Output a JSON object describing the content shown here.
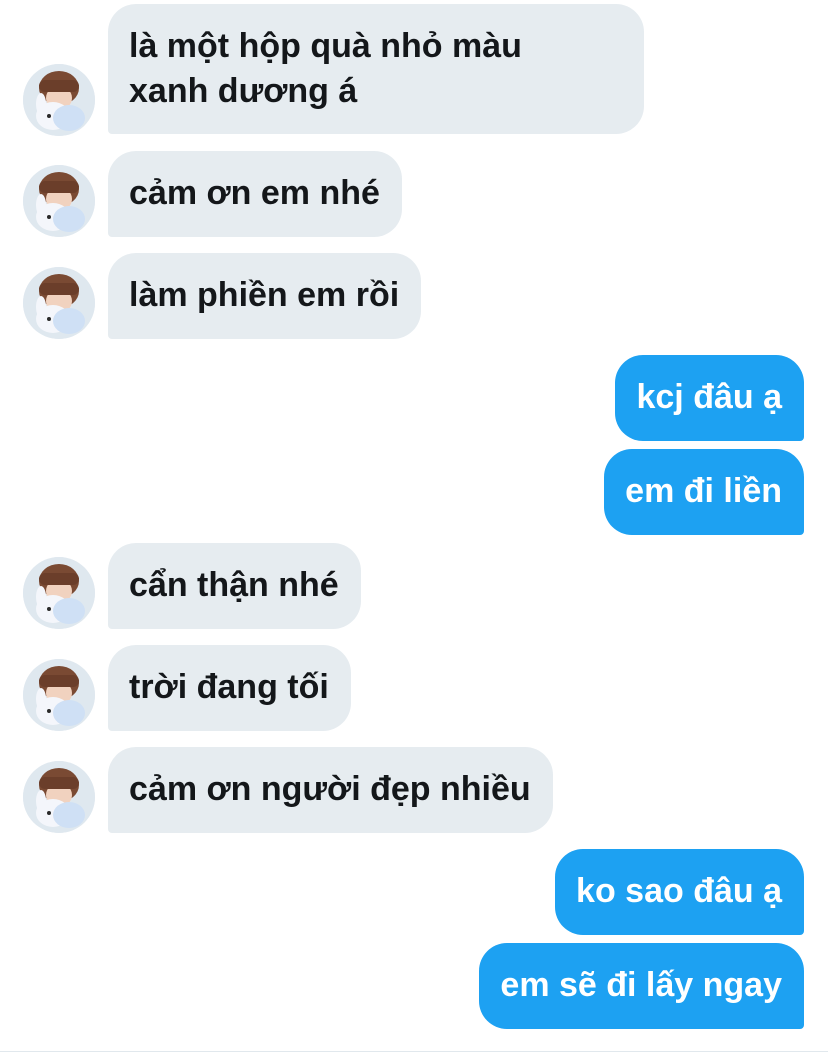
{
  "conversation": {
    "messages": [
      {
        "sender": "other",
        "text": "là một hộp quà nhỏ màu\nxanh dương á"
      },
      {
        "sender": "other",
        "text": "cảm ơn em nhé"
      },
      {
        "sender": "other",
        "text": "làm phiền em rồi"
      },
      {
        "sender": "me",
        "text": "kcj đâu ạ"
      },
      {
        "sender": "me",
        "text": "em đi liền"
      },
      {
        "sender": "other",
        "text": "cẩn thận nhé"
      },
      {
        "sender": "other",
        "text": "trời đang tối"
      },
      {
        "sender": "other",
        "text": "cảm ơn người đẹp nhiều"
      },
      {
        "sender": "me",
        "text": "ko sao đâu ạ"
      },
      {
        "sender": "me",
        "text": "em sẽ đi lấy ngay"
      }
    ]
  },
  "colors": {
    "incoming_bubble": "#e6ecf0",
    "incoming_text": "#14171a",
    "outgoing_bubble": "#1da1f2",
    "outgoing_text": "#ffffff",
    "background": "#ffffff"
  },
  "icons": {
    "avatar": "user-avatar-photo"
  }
}
